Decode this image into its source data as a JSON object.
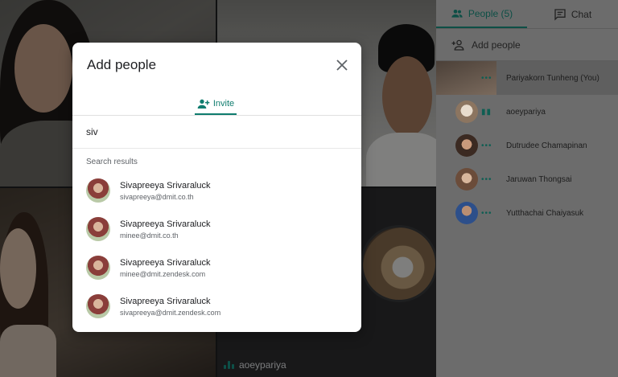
{
  "dialog": {
    "title": "Add people",
    "tab_invite": "Invite",
    "search_value": "siv",
    "results_header": "Search results",
    "results": [
      {
        "name": "Sivapreeya Srivaraluck",
        "email": "sivapreeya@dmit.co.th"
      },
      {
        "name": "Sivapreeya Srivaraluck",
        "email": "minee@dmit.co.th"
      },
      {
        "name": "Sivapreeya Srivaraluck",
        "email": "minee@dmit.zendesk.com"
      },
      {
        "name": "Sivapreeya Srivaraluck",
        "email": "sivapreeya@dmit.zendesk.com"
      }
    ]
  },
  "panel": {
    "tab_people": "People (5)",
    "tab_chat": "Chat",
    "add_people": "Add people",
    "participants": [
      {
        "name": "Pariyakorn Tunheng (You)"
      },
      {
        "name": "aoeypariya"
      },
      {
        "name": "Dutrudee Chamapinan"
      },
      {
        "name": "Jaruwan Thongsai"
      },
      {
        "name": "Yutthachai Chaiyasuk"
      }
    ]
  },
  "stage": {
    "tile_label": "aoeypariya"
  },
  "colors": {
    "accent": "#0f7c6e",
    "panel_bg": "#6c6c6c"
  }
}
